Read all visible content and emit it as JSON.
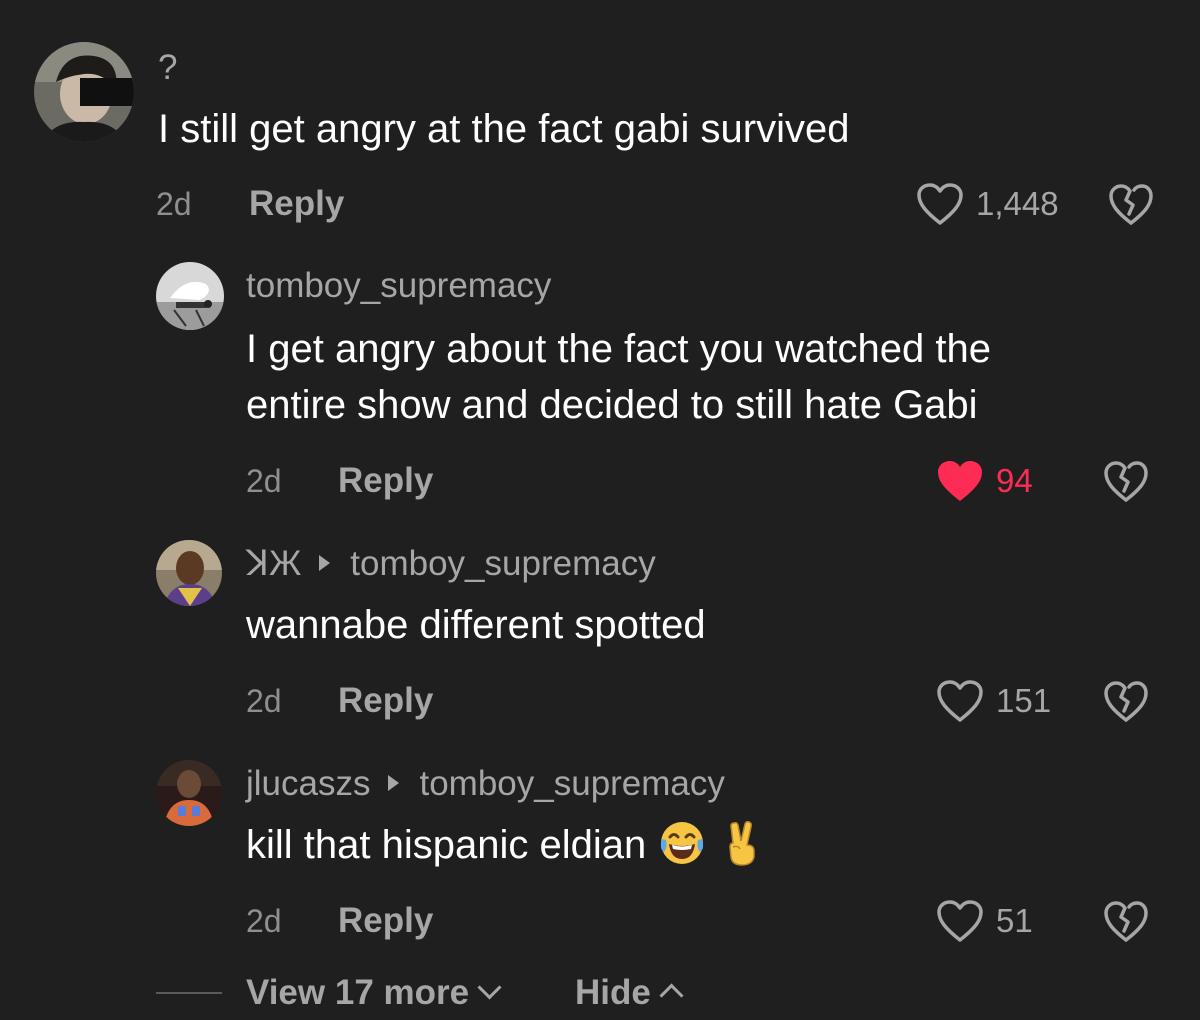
{
  "comments": [
    {
      "username": "?",
      "text": "I still get angry at the fact gabi survived",
      "time": "2d",
      "reply_label": "Reply",
      "likes": "1,448",
      "liked": false
    },
    {
      "username": "tomboy_supremacy",
      "text_lines": [
        "I get angry about the fact you watched the",
        "entire show and decided to still hate Gabi"
      ],
      "time": "2d",
      "reply_label": "Reply",
      "likes": "94",
      "liked": true
    },
    {
      "username": "ꓘЖ",
      "reply_to": "tomboy_supremacy",
      "text": "wannabe different spotted",
      "time": "2d",
      "reply_label": "Reply",
      "likes": "151",
      "liked": false
    },
    {
      "username": "jlucaszs",
      "reply_to": "tomboy_supremacy",
      "text": "kill that hispanic eldian",
      "emojis": [
        "laughing-tears-emoji",
        "victory-hand-emoji"
      ],
      "time": "2d",
      "reply_label": "Reply",
      "likes": "51",
      "liked": false
    }
  ],
  "footer": {
    "view_more": "View 17 more",
    "hide": "Hide"
  },
  "colors": {
    "background": "#1f1f1f",
    "liked_heart": "#fe2c55",
    "secondary_text": "#a6a6a6"
  }
}
